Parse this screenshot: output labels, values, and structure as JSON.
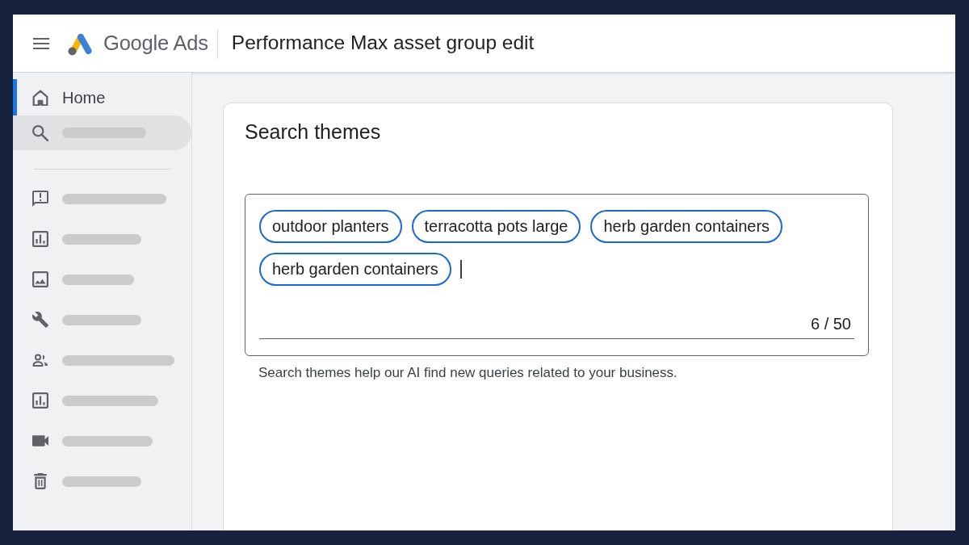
{
  "header": {
    "product_name": "Google Ads",
    "page_title": "Performance Max asset group edit"
  },
  "sidebar": {
    "sections": [
      {
        "items": [
          {
            "kind": "text",
            "label": "Home",
            "selected": true,
            "hovered": false
          },
          {
            "kind": "skeleton",
            "selected": false,
            "hovered": true
          }
        ]
      },
      {
        "items": [
          {
            "kind": "skeleton",
            "selected": false,
            "hovered": false
          },
          {
            "kind": "skeleton",
            "selected": false,
            "hovered": false
          },
          {
            "kind": "skeleton",
            "selected": false,
            "hovered": false
          },
          {
            "kind": "skeleton",
            "selected": false,
            "hovered": false
          },
          {
            "kind": "skeleton",
            "selected": false,
            "hovered": false
          },
          {
            "kind": "skeleton",
            "selected": false,
            "hovered": false
          },
          {
            "kind": "skeleton",
            "selected": false,
            "hovered": false
          },
          {
            "kind": "skeleton",
            "selected": false,
            "hovered": false
          }
        ]
      }
    ]
  },
  "card": {
    "title": "Search themes",
    "field": {
      "chips": [
        "outdoor planters",
        "terracotta pots large",
        "herb garden containers",
        "herb garden containers"
      ],
      "focused": true,
      "counter": "6 / 50"
    },
    "helper_text": "Search themes help our AI find new queries related to your business."
  }
}
